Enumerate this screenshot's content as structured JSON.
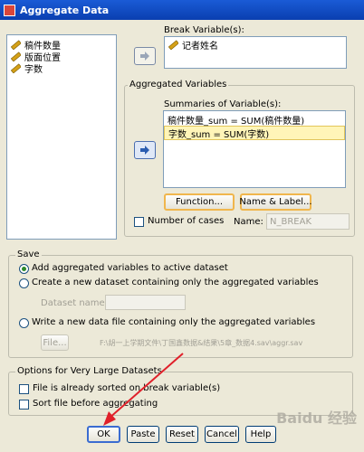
{
  "window": {
    "title": "Aggregate Data"
  },
  "source_list": {
    "items": [
      "稿件数量",
      "版面位置",
      "字数"
    ]
  },
  "break": {
    "label": "Break Variable(s):",
    "items": [
      "记者姓名"
    ]
  },
  "aggregated": {
    "legend": "Aggregated Variables",
    "summaries_label": "Summaries of Variable(s):",
    "items": [
      "稿件数量_sum = SUM(稿件数量)",
      "字数_sum = SUM(字数)"
    ],
    "function_label": "Function...",
    "name_label_label": "Name & Label...",
    "num_cases_label": "Number of cases",
    "name_label": "Name:",
    "name_value": "N_BREAK"
  },
  "save": {
    "legend": "Save",
    "option1": "Add aggregated variables to active dataset",
    "option2": "Create a new dataset containing only the aggregated variables",
    "dataset_name_label": "Dataset name:",
    "option3": "Write a new data file containing only the aggregated variables",
    "file_button": "File...",
    "file_path": "F:\\胡一上学期文件\\丁国鑫数据&结果\\5章_数据4.sav\\aggr.sav"
  },
  "large": {
    "legend": "Options for Very Large Datasets",
    "sorted_label": "File is already sorted on break variable(s)",
    "sort_before_label": "Sort file before aggregating"
  },
  "buttons": {
    "ok": "OK",
    "paste": "Paste",
    "reset": "Reset",
    "cancel": "Cancel",
    "help": "Help"
  },
  "watermark": "Baidu 经验",
  "colors": {
    "selection": "#fff5b8",
    "arrow": "#e0202a",
    "title_bar": "#0a3fb0"
  }
}
